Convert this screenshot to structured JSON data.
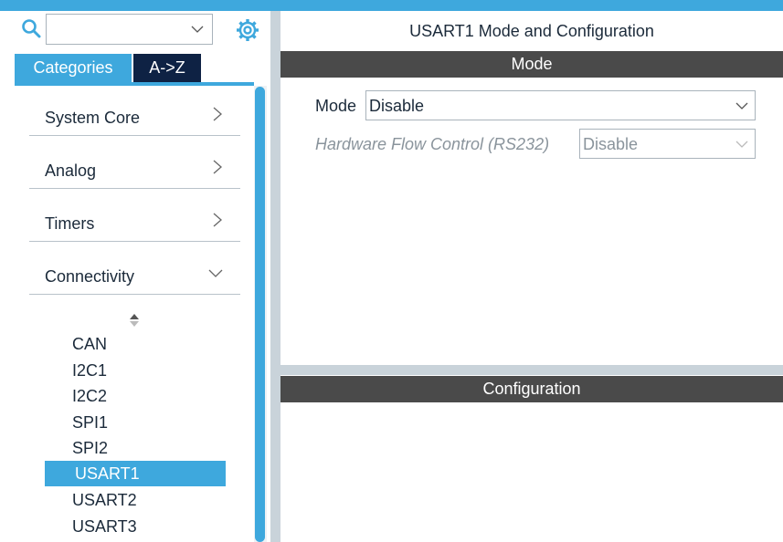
{
  "header": {
    "title": "USART1 Mode and Configuration"
  },
  "sidebar": {
    "search": {
      "value": ""
    },
    "tabs": [
      {
        "label": "Categories",
        "active": true
      },
      {
        "label": "A->Z",
        "active": false
      }
    ],
    "categories": [
      {
        "label": "System Core",
        "expanded": false
      },
      {
        "label": "Analog",
        "expanded": false
      },
      {
        "label": "Timers",
        "expanded": false
      },
      {
        "label": "Connectivity",
        "expanded": true
      }
    ],
    "peripherals": [
      {
        "label": "CAN",
        "selected": false
      },
      {
        "label": "I2C1",
        "selected": false
      },
      {
        "label": "I2C2",
        "selected": false
      },
      {
        "label": "SPI1",
        "selected": false
      },
      {
        "label": "SPI2",
        "selected": false
      },
      {
        "label": "USART1",
        "selected": true
      },
      {
        "label": "USART2",
        "selected": false
      },
      {
        "label": "USART3",
        "selected": false
      }
    ]
  },
  "mode_section": {
    "header": "Mode",
    "mode": {
      "label": "Mode",
      "value": "Disable"
    },
    "hardware_flow_control": {
      "label": "Hardware Flow Control (RS232)",
      "value": "Disable",
      "enabled": false
    }
  },
  "config_section": {
    "header": "Configuration"
  },
  "colors": {
    "accent": "#3ea8dd",
    "tab_dark": "#0e2244",
    "header_bar": "#4a4a4a"
  }
}
